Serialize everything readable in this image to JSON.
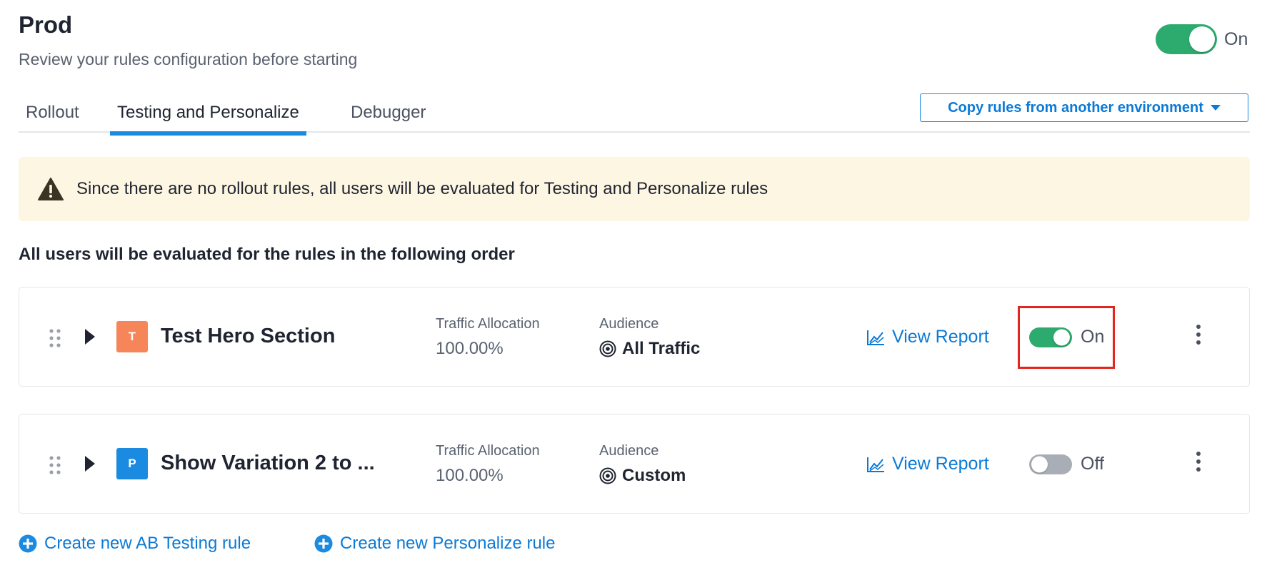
{
  "header": {
    "title": "Prod",
    "subtitle": "Review your rules configuration before starting",
    "env_toggle_label": "On"
  },
  "tabs": [
    {
      "label": "Rollout",
      "active": false
    },
    {
      "label": "Testing and Personalize",
      "active": true
    },
    {
      "label": "Debugger",
      "active": false
    }
  ],
  "copy_button": {
    "label": "Copy rules from another environment",
    "icon": "caret-down-icon"
  },
  "warning": {
    "icon": "warning-icon",
    "text": "Since there are no rollout rules, all users will be evaluated for Testing and Personalize rules"
  },
  "order_heading": "All users will be evaluated for the rules in the following order",
  "rules": [
    {
      "badge": "T",
      "name": "Test Hero Section",
      "traffic_label": "Traffic Allocation",
      "traffic_value": "100.00%",
      "audience_label": "Audience",
      "audience_value": "All Traffic",
      "view_report": "View Report",
      "toggle_label": "On",
      "toggle_on": true
    },
    {
      "badge": "P",
      "name": "Show Variation 2 to ...",
      "traffic_label": "Traffic Allocation",
      "traffic_value": "100.00%",
      "audience_label": "Audience",
      "audience_value": "Custom",
      "view_report": "View Report",
      "toggle_label": "Off",
      "toggle_on": false
    }
  ],
  "create_links": [
    {
      "label": "Create new AB Testing rule"
    },
    {
      "label": "Create new Personalize rule"
    }
  ],
  "colors": {
    "accent": "#1a8be0",
    "toggle_on": "#2daa6d",
    "toggle_off": "#a9aeb6",
    "warning_bg": "#fdf6e3",
    "highlight": "#e2261d",
    "badge_t": "#f7855a",
    "badge_p": "#1a8be0"
  }
}
